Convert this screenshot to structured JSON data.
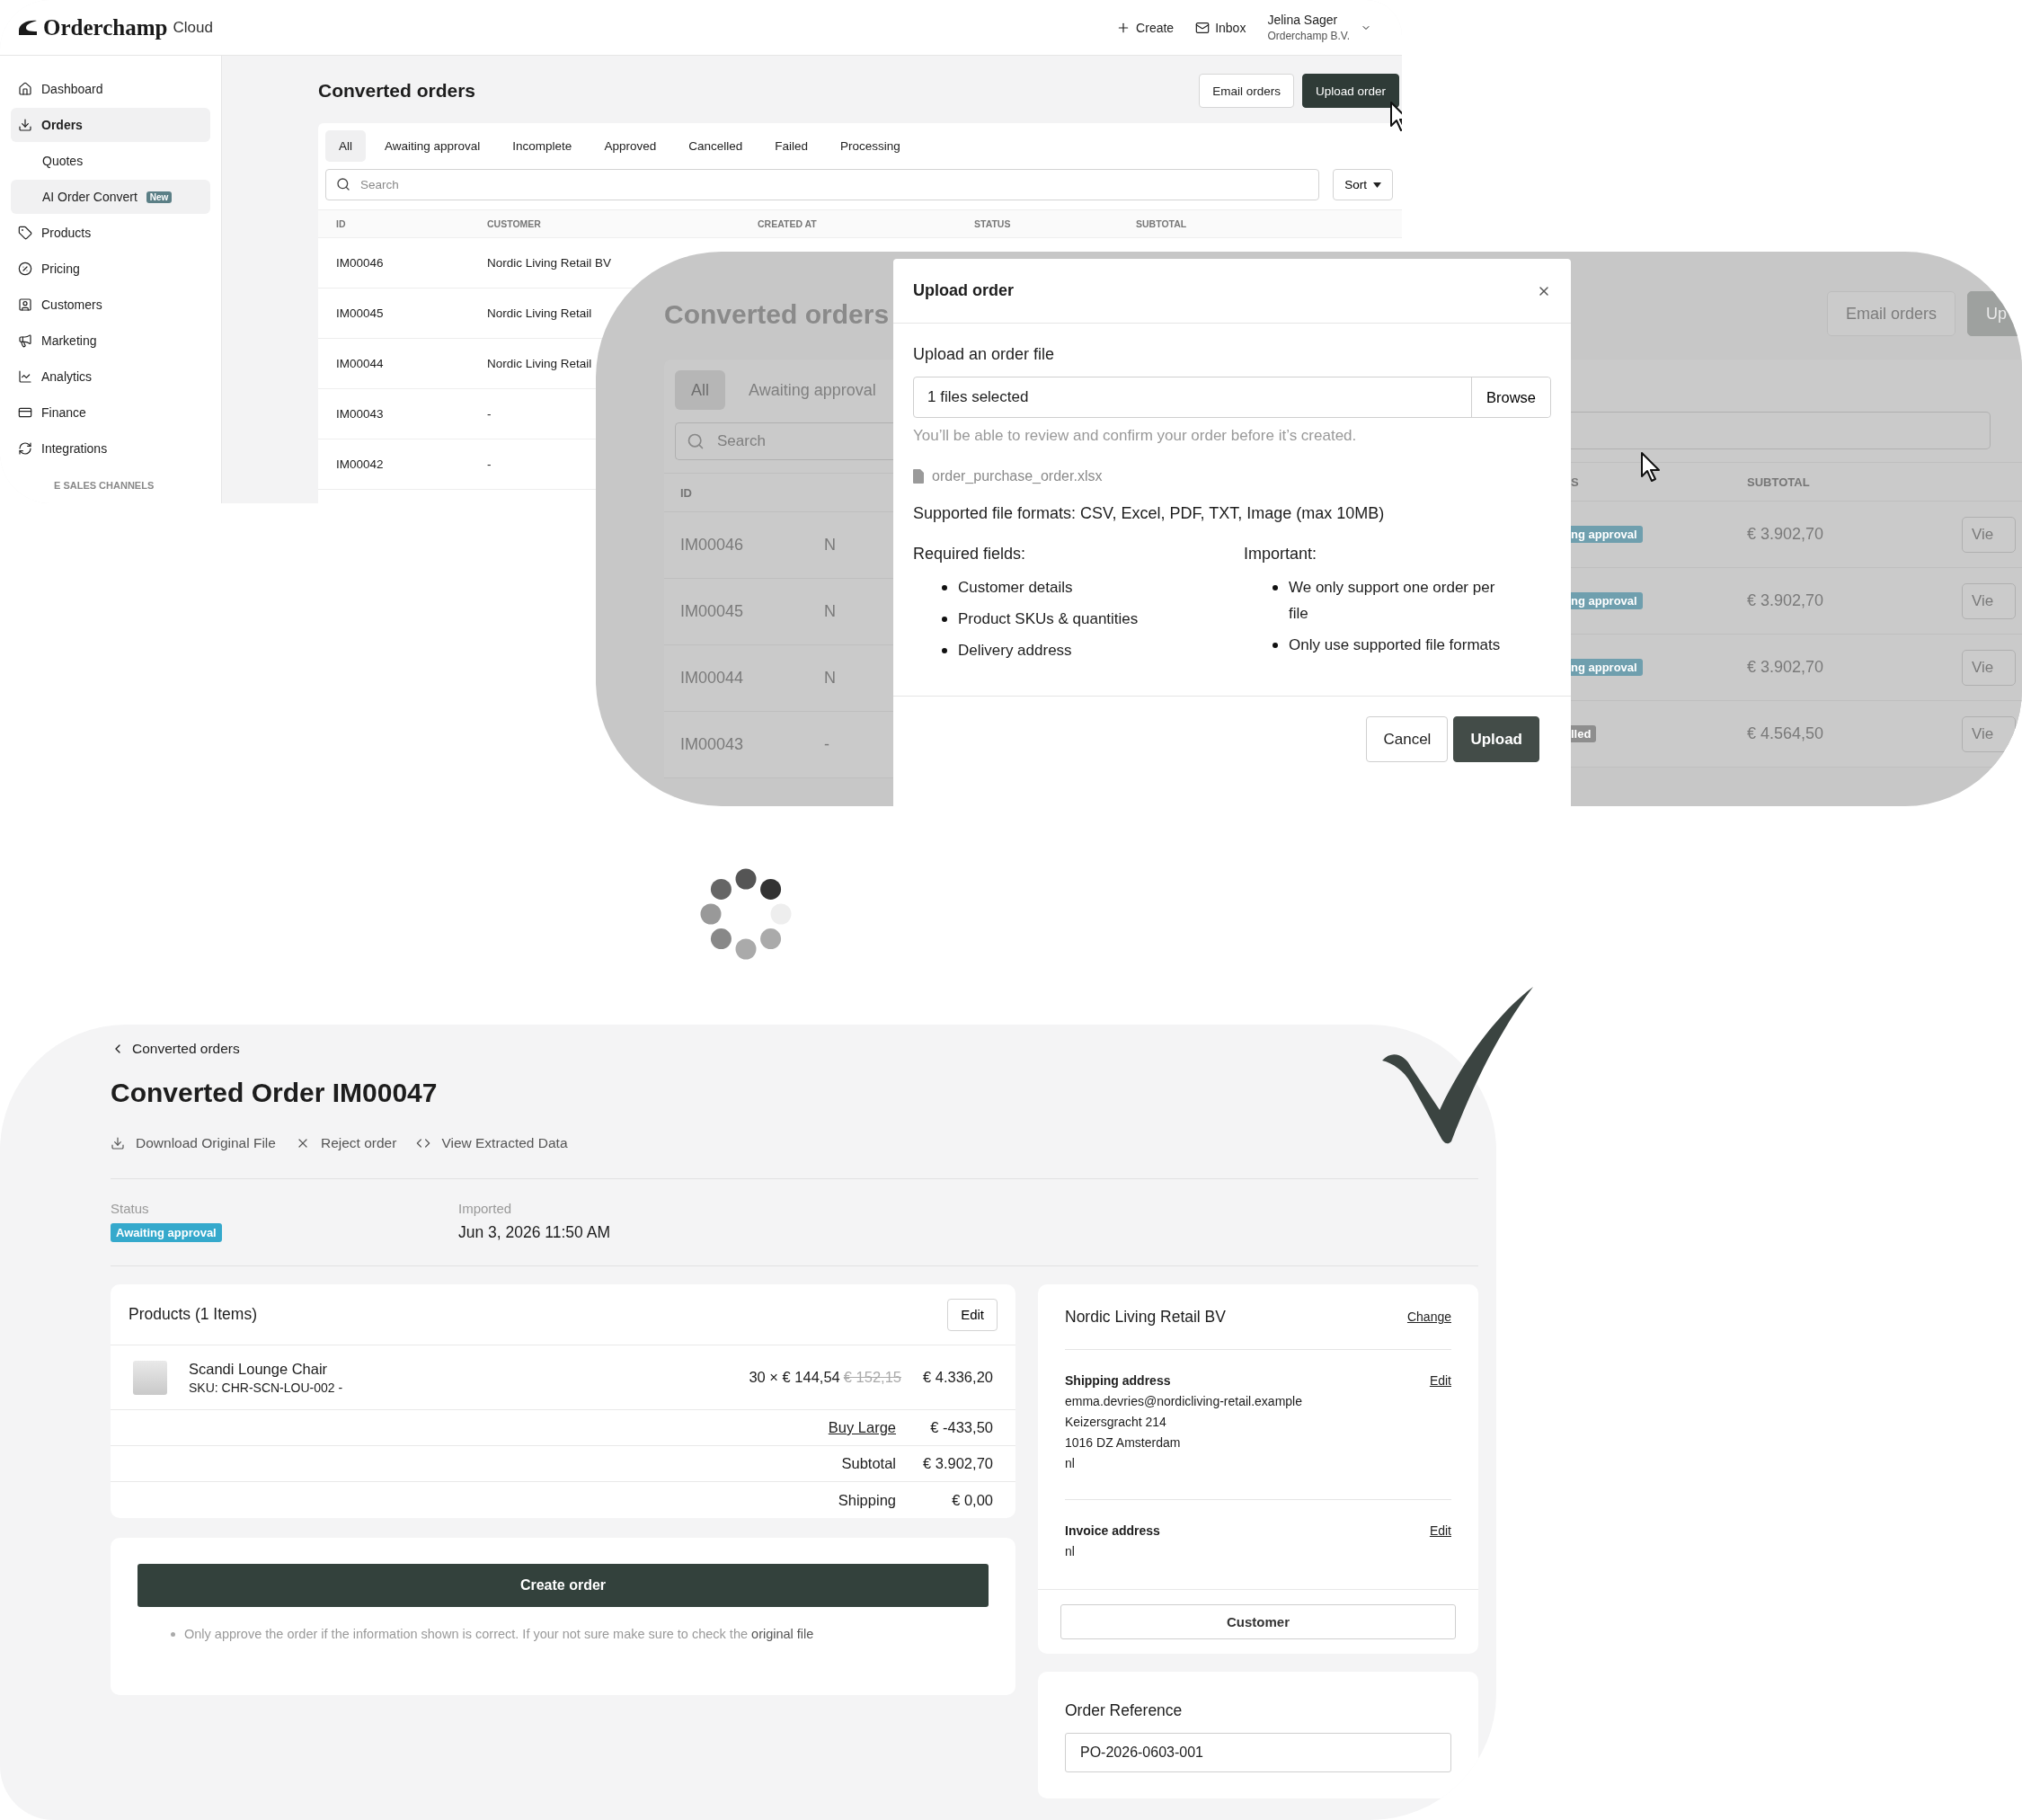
{
  "app": {
    "logo": "Orderchamp",
    "logo_suffix": "Cloud",
    "header_actions": [
      {
        "label": "Create"
      },
      {
        "label": "Inbox"
      }
    ],
    "user": {
      "name": "Jelina Sager",
      "company": "Orderchamp B.V."
    }
  },
  "sidebar": {
    "items": [
      {
        "label": "Dashboard",
        "kind": "main",
        "selected": false
      },
      {
        "label": "Orders",
        "kind": "main",
        "selected": true
      },
      {
        "label": "Quotes",
        "kind": "sub",
        "selected": false
      },
      {
        "label": "AI Order Convert",
        "kind": "sub",
        "selected": true,
        "badge": "New"
      },
      {
        "label": "Products",
        "kind": "main",
        "selected": false
      },
      {
        "label": "Pricing",
        "kind": "main",
        "selected": false
      },
      {
        "label": "Customers",
        "kind": "main",
        "selected": false
      },
      {
        "label": "Marketing",
        "kind": "main",
        "selected": false
      },
      {
        "label": "Analytics",
        "kind": "main",
        "selected": false
      },
      {
        "label": "Finance",
        "kind": "main",
        "selected": false
      },
      {
        "label": "Integrations",
        "kind": "main",
        "selected": false
      }
    ],
    "section": "E SALES CHANNELS"
  },
  "list_page": {
    "title": "Converted orders",
    "buttons": [
      {
        "label": "Email orders",
        "primary": false
      },
      {
        "label": "Upload order",
        "primary": true
      }
    ],
    "tabs": [
      {
        "label": "All",
        "selected": true
      },
      {
        "label": "Awaiting approval",
        "selected": false
      },
      {
        "label": "Incomplete",
        "selected": false
      },
      {
        "label": "Approved",
        "selected": false
      },
      {
        "label": "Cancelled",
        "selected": false
      },
      {
        "label": "Failed",
        "selected": false
      },
      {
        "label": "Processing",
        "selected": false
      }
    ],
    "search": {
      "placeholder": "Search"
    },
    "sort": "Sort",
    "columns": [
      "ID",
      "CUSTOMER",
      "CREATED AT",
      "STATUS",
      "SUBTOTAL"
    ],
    "rows": [
      {
        "id": "IM00046",
        "customer": "Nordic Living Retail BV"
      },
      {
        "id": "IM00045",
        "customer": "Nordic Living Retail"
      },
      {
        "id": "IM00044",
        "customer": "Nordic Living Retail"
      },
      {
        "id": "IM00043",
        "customer": "-"
      },
      {
        "id": "IM00042",
        "customer": "-"
      }
    ]
  },
  "dimmed_page": {
    "title": "Converted orders",
    "buttons": [
      "Email orders",
      "Up"
    ],
    "tabs": [
      {
        "label": "All",
        "selected": true
      },
      {
        "label": "Awaiting approval",
        "selected": false
      }
    ],
    "search": {
      "placeholder": "Search"
    },
    "left_columns": [
      "ID"
    ],
    "right_columns": [
      "S",
      "SUBTOTAL"
    ],
    "rows": [
      {
        "id": "IM00046",
        "customer": "N",
        "status": "ng approval",
        "color": "#6f9fae",
        "subtotal": "€ 3.902,70",
        "action": "Vie"
      },
      {
        "id": "IM00045",
        "customer": "N",
        "status": "ng approval",
        "color": "#6f9fae",
        "subtotal": "€ 3.902,70",
        "action": "Vie"
      },
      {
        "id": "IM00044",
        "customer": "N",
        "status": "ng approval",
        "color": "#6f9fae",
        "subtotal": "€ 3.902,70",
        "action": "Vie"
      },
      {
        "id": "IM00043",
        "customer": "-",
        "status": "lled",
        "color": "#8e8e8e",
        "subtotal": "€ 4.564,50",
        "action": "Vie"
      }
    ]
  },
  "upload_dialog": {
    "title": "Upload order",
    "field_label": "Upload an order file",
    "file_value": "1 files selected",
    "browse": "Browse",
    "hint": "You’ll be able to review and confirm your order before it’s created.",
    "file_name": "order_purchase_order.xlsx",
    "formats": "Supported file formats: CSV, Excel, PDF, TXT, Image (max 10MB)",
    "columns": [
      {
        "title": "Required fields:",
        "items": [
          "Customer details",
          "Product SKUs & quantities",
          "Delivery address"
        ]
      },
      {
        "title": "Important:",
        "items": [
          "We only support one order per file",
          "Only use supported file formats"
        ]
      }
    ],
    "buttons": [
      {
        "label": "Cancel",
        "primary": false
      },
      {
        "label": "Upload",
        "primary": true
      }
    ]
  },
  "order": {
    "back": "Converted orders",
    "title": "Converted Order IM00047",
    "actions": [
      {
        "label": "Download Original File"
      },
      {
        "label": "Reject order"
      },
      {
        "label": "View Extracted Data"
      }
    ],
    "status": {
      "label": "Status",
      "badge": "Awaiting approval"
    },
    "imported": {
      "label": "Imported",
      "value": "Jun 3, 2026 11:50 AM"
    },
    "products": {
      "title": "Products (1 Items)",
      "edit": "Edit",
      "items": [
        {
          "name": "Scandi Lounge Chair",
          "sku": "SKU: CHR-SCN-LOU-002 -",
          "qty_price": "30 × € 144,54",
          "old_price": "€ 152,15",
          "total": "€ 4.336,20"
        }
      ],
      "summary": [
        {
          "label": "Buy Large",
          "value": "€ -433,50",
          "link": true
        },
        {
          "label": "Subtotal",
          "value": "€ 3.902,70",
          "link": false
        },
        {
          "label": "Shipping",
          "value": "€ 0,00",
          "link": false
        }
      ]
    },
    "create": {
      "button": "Create order",
      "note": "Only approve the order if the information shown is correct. If your not sure make sure to check the",
      "note_link": "original file"
    },
    "customer": {
      "name": "Nordic Living Retail BV",
      "change": "Change",
      "sections": [
        {
          "title": "Shipping address",
          "edit": "Edit",
          "lines": [
            "emma.devries@nordicliving-retail.example",
            "Keizersgracht 214",
            "1016 DZ Amsterdam",
            "nl"
          ]
        },
        {
          "title": "Invoice address",
          "edit": "Edit",
          "lines": [
            "nl"
          ]
        }
      ],
      "button": "Customer"
    },
    "reference": {
      "label": "Order Reference",
      "value": "PO-2026-0603-001"
    }
  }
}
